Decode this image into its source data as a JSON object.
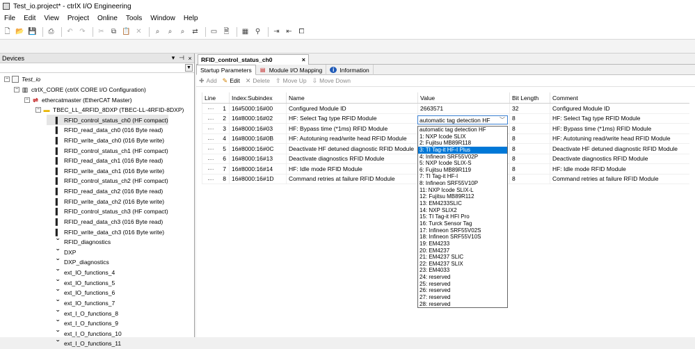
{
  "window": {
    "title": "Test_io.project* - ctrlX I/O Engineering"
  },
  "menu": [
    "File",
    "Edit",
    "View",
    "Project",
    "Online",
    "Tools",
    "Window",
    "Help"
  ],
  "toolbar_icons": [
    "new-project-icon",
    "open-icon",
    "save-icon",
    "print-icon",
    "undo-icon",
    "redo-icon",
    "cut-icon",
    "copy-icon",
    "paste-icon",
    "delete-icon",
    "find-icon",
    "find-next-icon",
    "find-previous-icon",
    "replace-icon",
    "window-icon",
    "file-icon",
    "device-icon",
    "scan-icon",
    "login-icon",
    "logout-icon",
    "bookmark-icon"
  ],
  "devices": {
    "title": "Devices",
    "tree": [
      {
        "label": "Test_io",
        "level": 0,
        "icon": "project-icon",
        "expander": "−",
        "italic": true
      },
      {
        "label": "ctrlX_CORE (ctrlX CORE I/O Configuration)",
        "level": 1,
        "icon": "controller-icon",
        "expander": "−"
      },
      {
        "label": "ethercatmaster (EtherCAT Master)",
        "level": 2,
        "icon": "ethercat-icon",
        "expander": "−"
      },
      {
        "label": "TBEC_LL_4RFID_8DXP (TBEC-LL-4RFID-8DXP)",
        "level": 3,
        "icon": "slave-icon",
        "expander": "−"
      },
      {
        "label": "RFID_control_status_ch0 (HF compact)",
        "level": 4,
        "icon": "module-icon",
        "selected": true
      },
      {
        "label": "RFID_read_data_ch0 (016 Byte read)",
        "level": 4,
        "icon": "module-icon"
      },
      {
        "label": "RFID_write_data_ch0 (016 Byte write)",
        "level": 4,
        "icon": "module-icon"
      },
      {
        "label": "RFID_control_status_ch1 (HF compact)",
        "level": 4,
        "icon": "module-icon"
      },
      {
        "label": "RFID_read_data_ch1 (016 Byte read)",
        "level": 4,
        "icon": "module-icon"
      },
      {
        "label": "RFID_write_data_ch1 (016 Byte write)",
        "level": 4,
        "icon": "module-icon"
      },
      {
        "label": "RFID_control_status_ch2 (HF compact)",
        "level": 4,
        "icon": "module-icon"
      },
      {
        "label": "RFID_read_data_ch2 (016 Byte read)",
        "level": 4,
        "icon": "module-icon"
      },
      {
        "label": "RFID_write_data_ch2 (016 Byte write)",
        "level": 4,
        "icon": "module-icon"
      },
      {
        "label": "RFID_control_status_ch3 (HF compact)",
        "level": 4,
        "icon": "module-icon"
      },
      {
        "label": "RFID_read_data_ch3 (016 Byte read)",
        "level": 4,
        "icon": "module-icon"
      },
      {
        "label": "RFID_write_data_ch3 (016 Byte write)",
        "level": 4,
        "icon": "module-icon"
      },
      {
        "label": "RFID_diagnostics",
        "level": 4,
        "icon": "slot-icon"
      },
      {
        "label": "DXP",
        "level": 4,
        "icon": "slot-icon"
      },
      {
        "label": "DXP_diagnostics",
        "level": 4,
        "icon": "slot-icon"
      },
      {
        "label": "ext_IO_functions_4",
        "level": 4,
        "icon": "slot-icon"
      },
      {
        "label": "ext_IO_functions_5",
        "level": 4,
        "icon": "slot-icon"
      },
      {
        "label": "ext_IO_functions_6",
        "level": 4,
        "icon": "slot-icon"
      },
      {
        "label": "ext_IO_functions_7",
        "level": 4,
        "icon": "slot-icon"
      },
      {
        "label": "ext_I_O_functions_8",
        "level": 4,
        "icon": "slot-icon"
      },
      {
        "label": "ext_I_O_functions_9",
        "level": 4,
        "icon": "slot-icon"
      },
      {
        "label": "ext_I_O_functions_10",
        "level": 4,
        "icon": "slot-icon"
      },
      {
        "label": "ext_I_O_functions_11",
        "level": 4,
        "icon": "slot-icon"
      }
    ]
  },
  "editor": {
    "doc_tab": "RFID_control_status_ch0",
    "tabs": [
      "Startup Parameters",
      "Module I/O Mapping",
      "Information"
    ],
    "actions": [
      {
        "label": "Add",
        "icon": "add-icon",
        "enabled": false
      },
      {
        "label": "Edit",
        "icon": "edit-icon",
        "enabled": true
      },
      {
        "label": "Delete",
        "icon": "delete-icon",
        "enabled": false
      },
      {
        "label": "Move Up",
        "icon": "move-up-icon",
        "enabled": false
      },
      {
        "label": "Move Down",
        "icon": "move-down-icon",
        "enabled": false
      }
    ],
    "columns": [
      "Line",
      "Index:Subindex",
      "Name",
      "Value",
      "Bit Length",
      "Comment"
    ],
    "rows": [
      {
        "line": "1",
        "index": "16#5000:16#00",
        "name": "Configured Module ID",
        "value": "2663571",
        "bits": "32",
        "comment": "Configured Module ID"
      },
      {
        "line": "2",
        "index": "16#8000:16#02",
        "name": "HF: Select Tag type RFID Module",
        "value": "automatic tag detection HF",
        "bits": "8",
        "comment": "HF: Select Tag type RFID Module",
        "editing": true
      },
      {
        "line": "3",
        "index": "16#8000:16#03",
        "name": "HF: Bypass time (*1ms) RFID Module",
        "value": "",
        "bits": "8",
        "comment": "HF: Bypass time (*1ms) RFID Module"
      },
      {
        "line": "4",
        "index": "16#8000:16#0B",
        "name": "HF: Autotuning read/write head RFID Module",
        "value": "",
        "bits": "8",
        "comment": "HF: Autotuning read/write head RFID Module"
      },
      {
        "line": "5",
        "index": "16#8000:16#0C",
        "name": "Deactivate HF detuned diagnostic RFID Module",
        "value": "",
        "bits": "8",
        "comment": "Deactivate HF detuned diagnostic RFID Module"
      },
      {
        "line": "6",
        "index": "16#8000:16#13",
        "name": "Deactivate diagnostics RFID Module",
        "value": "",
        "bits": "8",
        "comment": "Deactivate diagnostics RFID Module"
      },
      {
        "line": "7",
        "index": "16#8000:16#14",
        "name": "HF: Idle mode RFID Module",
        "value": "",
        "bits": "8",
        "comment": "HF: Idle mode RFID Module"
      },
      {
        "line": "8",
        "index": "16#8000:16#1D",
        "name": "Command retries at failure RFID Module",
        "value": "",
        "bits": "8",
        "comment": "Command retries at failure RFID Module"
      }
    ],
    "dropdown": {
      "highlighted_index": 3,
      "options": [
        "automatic tag detection HF",
        "1: NXP Icode SLIX",
        "2: Fujitsu MB89R118",
        "3: TI Tag-it HF-I Plus",
        "4: Infineon SRF55V02P",
        "5: NXP Icode SLIX-S",
        "6: Fujitsu MB89R119",
        "7: TI Tag-it HF-I",
        "8: Infineon SRF55V10P",
        "11: NXP Icode SLIX-L",
        "12: Fujitsu MB89R112",
        "13: EM4233SLIC",
        "14: NXP SLIX2",
        "15: TI Tag-it HFI Pro",
        "16: Turck Sensor Tag",
        "17: Infineon SRF55V02S",
        "18: Infineon SRF55V10S",
        "19: EM4233",
        "20: EM4237",
        "21: EM4237 SLIC",
        "22: EM4237 SLIX",
        "23: EM4033",
        "24: reserved",
        "25: reserved",
        "26: reserved",
        "27: reserved",
        "28: reserved"
      ]
    }
  }
}
